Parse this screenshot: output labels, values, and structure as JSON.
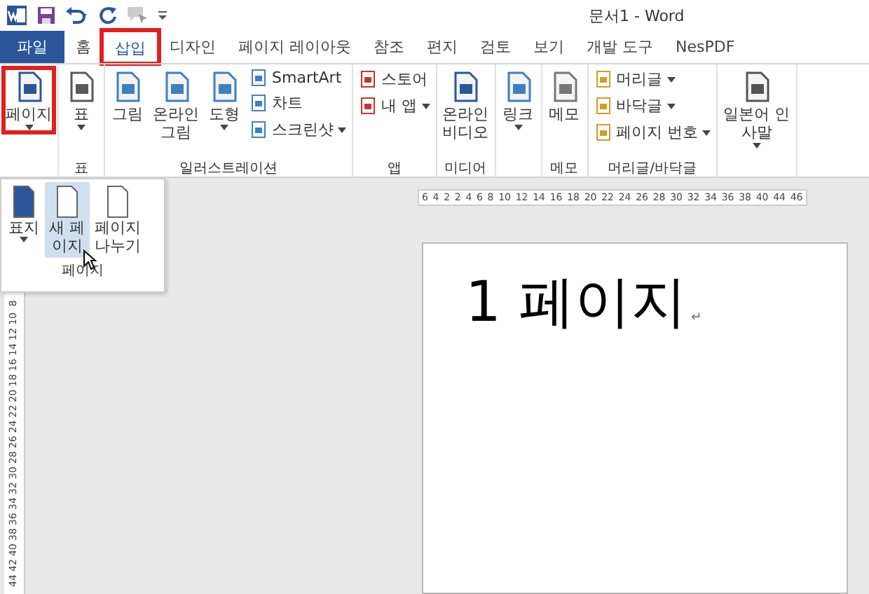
{
  "title_bar": {
    "title": "문서1 - Word"
  },
  "tabs": [
    {
      "label": "파일",
      "kind": "file",
      "selected": false,
      "highlighted": false
    },
    {
      "label": "홈",
      "kind": "tab",
      "selected": false,
      "highlighted": false
    },
    {
      "label": "삽입",
      "kind": "tab",
      "selected": true,
      "highlighted": true
    },
    {
      "label": "디자인",
      "kind": "tab",
      "selected": false,
      "highlighted": false
    },
    {
      "label": "페이지 레이아웃",
      "kind": "tab",
      "selected": false,
      "highlighted": false
    },
    {
      "label": "참조",
      "kind": "tab",
      "selected": false,
      "highlighted": false
    },
    {
      "label": "편지",
      "kind": "tab",
      "selected": false,
      "highlighted": false
    },
    {
      "label": "검토",
      "kind": "tab",
      "selected": false,
      "highlighted": false
    },
    {
      "label": "보기",
      "kind": "tab",
      "selected": false,
      "highlighted": false
    },
    {
      "label": "개발 도구",
      "kind": "tab",
      "selected": false,
      "highlighted": false
    },
    {
      "label": "NesPDF",
      "kind": "tab",
      "selected": false,
      "highlighted": false
    }
  ],
  "ribbon_groups": [
    {
      "items": [
        {
          "kind": "large",
          "lines": [
            "페이지"
          ],
          "dropdown": true,
          "highlighted": true
        }
      ]
    },
    {
      "label": "표",
      "items": [
        {
          "kind": "large",
          "lines": [
            "표"
          ],
          "dropdown": true,
          "highlighted": false
        }
      ]
    },
    {
      "label": "일러스트레이션",
      "items": [
        {
          "kind": "large",
          "lines": [
            "그림"
          ],
          "dropdown": false,
          "highlighted": false
        },
        {
          "kind": "large",
          "lines": [
            "온라인",
            "그림"
          ],
          "dropdown": false,
          "highlighted": false
        },
        {
          "kind": "large",
          "lines": [
            "도형"
          ],
          "dropdown": true,
          "highlighted": false
        },
        {
          "kind": "stack",
          "entries": [
            {
              "label": "SmartArt",
              "dropdown": false
            },
            {
              "label": "차트",
              "dropdown": false
            },
            {
              "label": "스크린샷",
              "dropdown": true
            }
          ]
        }
      ]
    },
    {
      "label": "앱",
      "items": [
        {
          "kind": "stack",
          "entries": [
            {
              "label": "스토어",
              "dropdown": false
            },
            {
              "label": "내 앱",
              "dropdown": true
            }
          ]
        }
      ]
    },
    {
      "label": "미디어",
      "items": [
        {
          "kind": "large",
          "lines": [
            "온라인",
            "비디오"
          ],
          "dropdown": false,
          "highlighted": false
        }
      ]
    },
    {
      "items": [
        {
          "kind": "large",
          "lines": [
            "링크"
          ],
          "dropdown": true,
          "highlighted": false
        }
      ]
    },
    {
      "label": "메모",
      "items": [
        {
          "kind": "large",
          "lines": [
            "메모"
          ],
          "dropdown": false,
          "highlighted": false
        }
      ]
    },
    {
      "label": "머리글/바닥글",
      "items": [
        {
          "kind": "stack",
          "entries": [
            {
              "label": "머리글",
              "dropdown": true
            },
            {
              "label": "바닥글",
              "dropdown": true
            },
            {
              "label": "페이지 번호",
              "dropdown": true
            }
          ]
        }
      ]
    },
    {
      "items": [
        {
          "kind": "large",
          "lines": [
            "일본어 인",
            "사말"
          ],
          "dropdown": true,
          "highlighted": false
        }
      ]
    }
  ],
  "page_menu": {
    "label": "페이지",
    "items": [
      {
        "lines": [
          "표지"
        ],
        "dropdown": true,
        "selected": false
      },
      {
        "lines": [
          "새 페",
          "이지"
        ],
        "dropdown": false,
        "selected": true
      },
      {
        "lines": [
          "페이지",
          "나누기"
        ],
        "dropdown": false,
        "selected": false
      }
    ]
  },
  "ruler": {
    "horizontal": [
      "6",
      "4",
      "2",
      "2",
      "4",
      "6",
      "8",
      "10",
      "12",
      "14",
      "16",
      "18",
      "20",
      "22",
      "24",
      "26",
      "28",
      "30",
      "32",
      "34",
      "36",
      "38",
      "40",
      "44",
      "46"
    ],
    "vertical": [
      "8",
      "10",
      "12",
      "14",
      "16",
      "18",
      "20",
      "22",
      "24",
      "26",
      "28",
      "30",
      "32",
      "34",
      "36",
      "38",
      "40",
      "42",
      "44"
    ]
  },
  "document": {
    "text": "1 페이지",
    "paragraph_mark": "↵"
  }
}
